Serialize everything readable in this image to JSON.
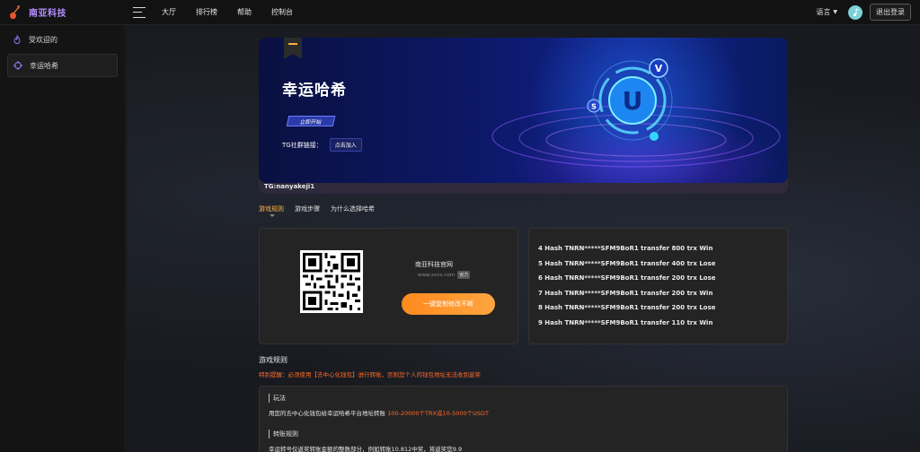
{
  "brand": {
    "name": "南亚科技",
    "logo_icon": "guitar-icon",
    "accent": "#b48cff"
  },
  "nav": [
    "大厅",
    "排行榜",
    "帮助",
    "控制台"
  ],
  "top_right": {
    "language_label": "语言",
    "logout_label": "退出登录"
  },
  "sidebar": {
    "items": [
      {
        "label": "受欢迎的",
        "icon": "flame-icon"
      },
      {
        "label": "幸运哈希",
        "icon": "crosshair-icon",
        "active": true
      }
    ]
  },
  "banner": {
    "title": "幸运哈希",
    "start_label": "立即开始",
    "tg_label": "TG社群链接：",
    "join_label": "点击加入",
    "footer": "TG:nanyakeji1"
  },
  "tabs": [
    "游戏规则",
    "游戏步骤",
    "为什么选择哈希"
  ],
  "qr_card": {
    "site_name": "南亚科技官网",
    "site_url": "www.xxxx.com",
    "official_badge": "官方",
    "copy_button": "一键复制修改不断"
  },
  "transactions": [
    "4 Hash TNRN*****SFM9BoR1 transfer 800 trx Win",
    "5 Hash TNRN*****SFM9BoR1 transfer 400 trx Lose",
    "6 Hash TNRN*****SFM9BoR1 transfer 200 trx Lose",
    "7 Hash TNRN*****SFM9BoR1 transfer 200 trx Win",
    "8 Hash TNRN*****SFM9BoR1 transfer 200 trx Lose",
    "9 Hash TNRN*****SFM9BoR1 transfer 110 trx Win"
  ],
  "rules": {
    "heading": "游戏规则",
    "warning": "特别提醒：必须使用【去中心化钱包】进行转账，否则您个人的钱包地址无法收到返奖",
    "section1_title": "玩法",
    "section1_text": "用您的去中心化钱包给幸运哈希平台地址转账 ",
    "section1_highlight": "100-20000个TRX或10-5000个USDT",
    "section2_title": "转账规则",
    "section2_text": "幸运转号仅返奖转账金额的整数部分，例如转账10.812中奖，将返奖您9.9"
  },
  "colors": {
    "orange": "#ff8a1e",
    "warning": "#ff6a2a",
    "banner_blue": "#10208a"
  }
}
